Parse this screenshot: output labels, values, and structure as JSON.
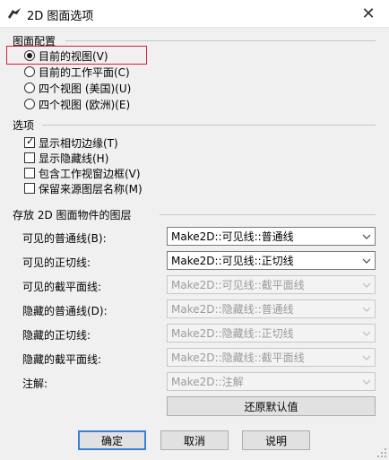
{
  "window": {
    "title": "2D 图面选项"
  },
  "layout_group": {
    "label": "图面配置",
    "options": [
      {
        "label": "目前的视图(V)",
        "checked": true
      },
      {
        "label": "目前的工作平面(C)",
        "checked": false
      },
      {
        "label": "四个视图 (美国)(U)",
        "checked": false
      },
      {
        "label": "四个视图 (欧洲)(E)",
        "checked": false
      }
    ]
  },
  "options_group": {
    "label": "选项",
    "checks": [
      {
        "label": "显示相切边缘(T)",
        "checked": true
      },
      {
        "label": "显示隐藏线(H)",
        "checked": false
      },
      {
        "label": "包含工作视窗边框(V)",
        "checked": false
      },
      {
        "label": "保留来源图层名称(M)",
        "checked": false
      }
    ]
  },
  "layers_group": {
    "label": "存放 2D 图面物件的图层",
    "rows": [
      {
        "label": "可见的普通线(B):",
        "value": "Make2D::可见线::普通线",
        "enabled": true
      },
      {
        "label": "可见的正切线:",
        "value": "Make2D::可见线::正切线",
        "enabled": true
      },
      {
        "label": "可见的截平面线:",
        "value": "Make2D::可见线::截平面线",
        "enabled": false
      },
      {
        "label": "隐藏的普通线(D):",
        "value": "Make2D::隐藏线::普通线",
        "enabled": false
      },
      {
        "label": "隐藏的正切线:",
        "value": "Make2D::隐藏线::正切线",
        "enabled": false
      },
      {
        "label": "隐藏的截平面线:",
        "value": "Make2D::隐藏线::截平面线",
        "enabled": false
      },
      {
        "label": "注解:",
        "value": "Make2D::注解",
        "enabled": false
      }
    ],
    "restore_label": "还原默认值"
  },
  "buttons": {
    "ok": "确定",
    "cancel": "取消",
    "help": "说明"
  },
  "colors": {
    "focus": "#d9232e",
    "default_button_border": "#3c7fd6",
    "dialog_bg": "#f0f0f0"
  }
}
